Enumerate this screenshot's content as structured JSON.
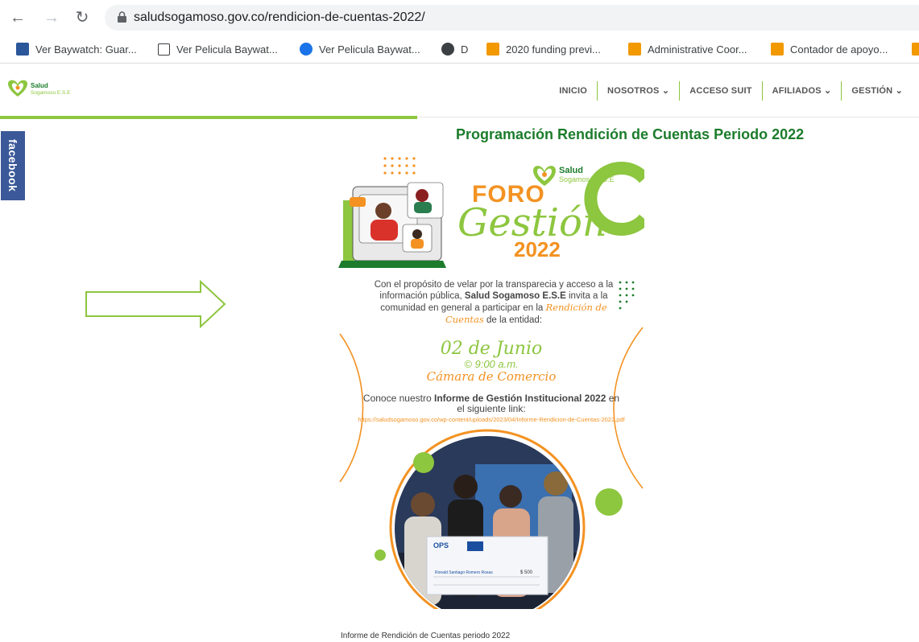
{
  "browser": {
    "url": "saludsogamoso.gov.co/rendicion-de-cuentas-2022/",
    "bookmarks": [
      {
        "label": "Ver Baywatch: Guar...",
        "icon": "baywatch-icon"
      },
      {
        "label": "Ver Pelicula Baywat...",
        "icon": "film-icon"
      },
      {
        "label": "Ver Pelicula Baywat...",
        "icon": "play-icon"
      },
      {
        "label": "D",
        "icon": "globe-icon"
      },
      {
        "label": "2020 funding previ...",
        "icon": "doc-icon"
      },
      {
        "label": "Administrative Coor...",
        "icon": "doc-icon"
      },
      {
        "label": "Contador de apoyo...",
        "icon": "doc-icon"
      }
    ]
  },
  "site": {
    "logo_text": "Salud",
    "logo_sub": "Sogamoso E.S.E",
    "menu": [
      "INICIO",
      "NOSOTROS ⌄",
      "ACCESO SUIT",
      "AFILIADOS ⌄",
      "GESTIÓN ⌄"
    ],
    "facebook_tab": "facebook",
    "page_title": "Programación Rendición de Cuentas Periodo 2022",
    "footer_link": "Informe de Rendición de Cuentas periodo 2022"
  },
  "poster": {
    "logo_text": "Salud",
    "logo_sub": "Sogamoso E.S.E",
    "foro": "FORO",
    "gestion": "Gestión",
    "year": "2022",
    "invite_1": "Con el propósito de velar por la transparecia y acceso a la información pública, ",
    "invite_bold": "Salud Sogamoso E.S.E",
    "invite_2": " invita a la comunidad en general a participar en la ",
    "invite_script": "Rendición de Cuentas",
    "invite_3": " de la entidad:",
    "date": "02 de Junio",
    "time": "© 9:00 a.m.",
    "place": "Cámara de Comercio",
    "informe_1": "Conoce nuestro ",
    "informe_bold": "Informe de Gestión Institucional 2022",
    "informe_2": " en el siguiente link:",
    "link": "https://saludsogamoso.gov.co/wp-content/uploads/2023/04/Informe-Rendicion-de-Cuentas-2022.pdf",
    "check_brand": "OPS",
    "check_amount": "$ 500",
    "check_name": "Ronald Santiago Romero Rosas"
  },
  "colors": {
    "green": "#8dc63f",
    "dark_green": "#1c7c2c",
    "orange": "#f39222",
    "facebook": "#3b5998"
  }
}
